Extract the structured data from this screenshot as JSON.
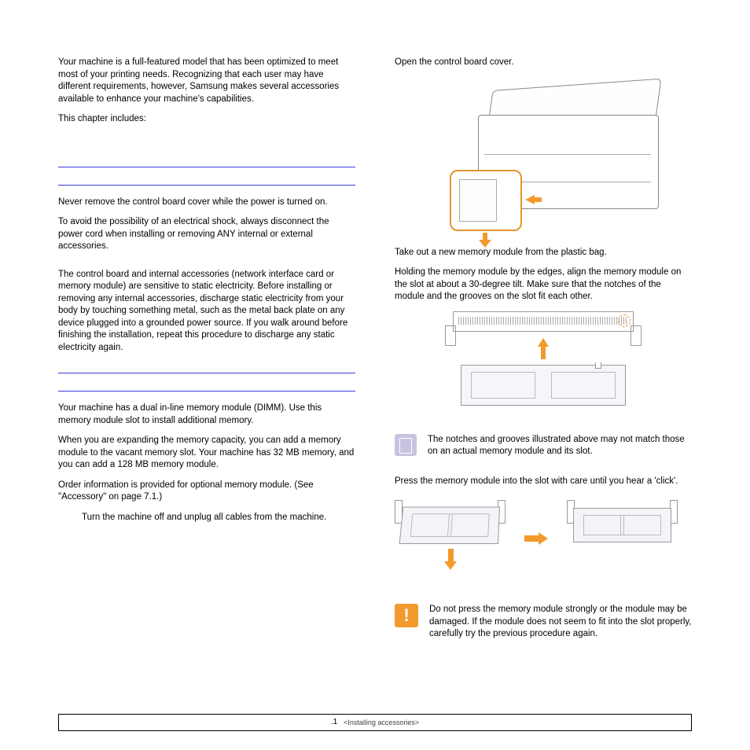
{
  "left": {
    "intro": "Your machine is a full-featured model that has been optimized to meet most of your printing needs. Recognizing that each user may have different requirements, however, Samsung makes several accessories available to enhance your machine's capabilities.",
    "includes": "This chapter includes:",
    "precautionsHeading": "",
    "prec1": "Never remove the control board cover while the power is turned on.",
    "prec2": "To avoid the possibility of an electrical shock, always disconnect the power cord when installing or removing ANY internal or external accessories.",
    "prec3": "The control board and internal accessories (network interface card or memory module) are sensitive to static electricity. Before installing or removing any internal accessories, discharge static electricity from your body by touching something metal, such as the metal back plate on any device plugged into a grounded power source. If you walk around before finishing the installation, repeat this procedure to discharge any static electricity again.",
    "memHeading": "",
    "mem1": "Your machine has a dual in-line memory module (DIMM). Use this memory module slot to install additional memory.",
    "mem2": "When you are expanding the memory capacity, you can add a memory module to the vacant memory slot. Your machine has 32 MB memory, and you can add a 128 MB memory module.",
    "mem3": "Order information is provided for optional memory module. (See \"Accessory\" on page 7.1.)",
    "step1": "Turn the machine off and unplug all cables from the machine."
  },
  "right": {
    "openCover": "Open the control board cover.",
    "takeOut": "Take out a new memory module from the plastic bag.",
    "holding": "Holding the memory module by the edges, align the memory module on the slot at about a 30-degree tilt. Make sure that the notches of the module and the grooves on the slot fit each other.",
    "noteNotches": "The notches and grooves illustrated above may not match those on an actual memory module and its slot.",
    "press": "Press the memory module into the slot with care until you hear a 'click'.",
    "caution": "Do not press the memory module strongly or the module may be damaged. If the module does not seem to fit into the slot properly, carefully try the previous procedure again."
  },
  "footer": {
    "page": ".1",
    "section": "<Installing accessories>"
  }
}
